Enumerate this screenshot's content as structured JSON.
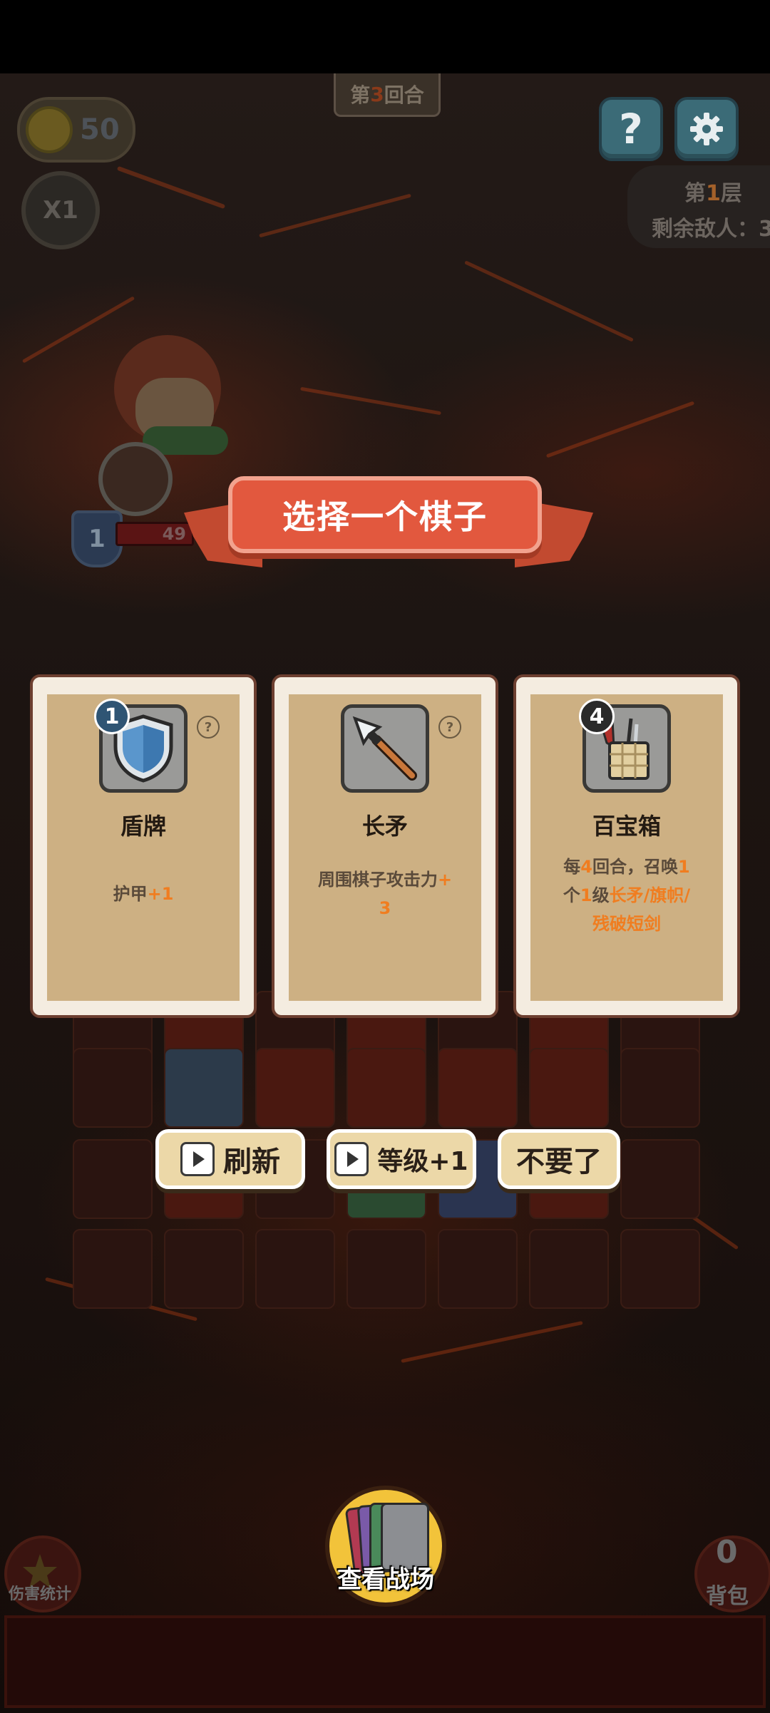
{
  "hud": {
    "round_prefix": "第",
    "round_number": "3",
    "round_suffix": "回合",
    "coins": "50",
    "speed": "X1",
    "help": "?",
    "floor_prefix": "第",
    "floor_number": "1",
    "floor_suffix": "层",
    "enemies_label": "剩余敌人：3"
  },
  "hero": {
    "armor": "1",
    "hp": "49"
  },
  "dialog": {
    "title": "选择一个棋子",
    "cards": [
      {
        "name": "盾牌",
        "level": "1",
        "icon": "shield-icon",
        "help": "?",
        "desc_parts": [
          "护甲",
          "+1"
        ]
      },
      {
        "name": "长矛",
        "icon": "spear-icon",
        "help": "?",
        "desc_parts": [
          "周围棋子攻击力",
          "+",
          "3"
        ]
      },
      {
        "name": "百宝箱",
        "level": "4",
        "icon": "treasure-box-icon",
        "desc_parts": [
          "每",
          "4",
          "回合，召唤",
          "1",
          "个",
          "1",
          "级",
          "长矛/旗帜/",
          "残破短剑"
        ]
      }
    ],
    "buttons": {
      "refresh": "刷新",
      "level_up": "等级+1",
      "skip": "不要了"
    }
  },
  "bottom": {
    "damage_stats": "伤害统计",
    "battlefield": "查看战场",
    "bag_count": "0",
    "bag": "背包"
  },
  "colors": {
    "ribbon": "#e2583e",
    "card_paper": "#cdb083",
    "highlight": "#f07d20",
    "button": "#ecd8a8",
    "help_button": "#3b6b77"
  }
}
